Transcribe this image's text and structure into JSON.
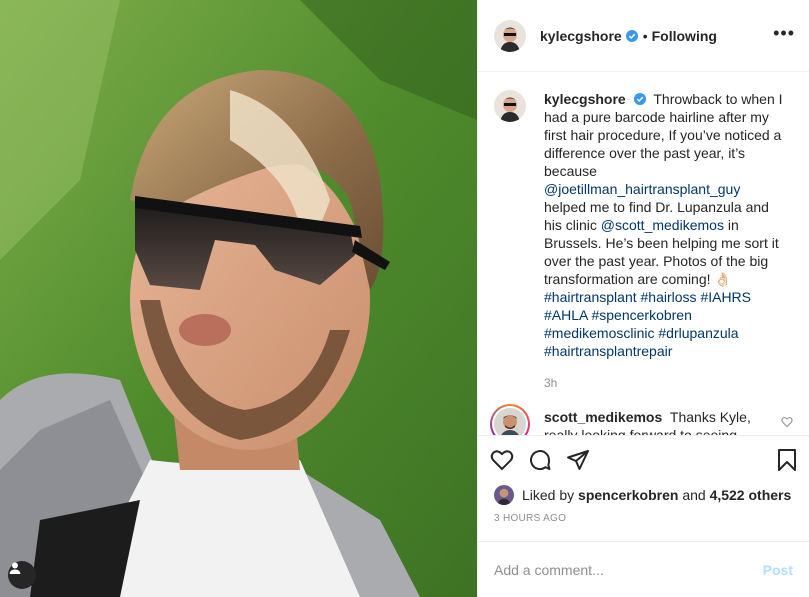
{
  "header": {
    "username": "kylecgshore",
    "separator": "•",
    "follow_status": "Following",
    "more_label": "•••"
  },
  "caption": {
    "username": "kylecgshore",
    "text_1": "Throwback to when I had a pure barcode hairline after my first hair procedure, If you’ve noticed a difference over the past year, it’s because",
    "mention_1": "@joetillman_hairtransplant_guy",
    "text_2": "helped me to find Dr. Lupanzula and his clinic",
    "mention_2": "@scott_medikemos",
    "text_3": "in Brussels. He’s been helping me sort it over the past year. Photos of the big transformation are coming! 👌🏻",
    "hashtags": [
      "#hairtransplant",
      "#hairloss",
      "#IAHRS",
      "#AHLA",
      "#spencerkobren",
      "#medikemosclinic",
      "#drlupanzula",
      "#hairtransplantrepair"
    ],
    "age": "3h"
  },
  "comment": {
    "username": "scott_medikemos",
    "text": "Thanks Kyle, really looking forward to seeing your updated pics 🤞🏼"
  },
  "actions": {
    "icons": [
      "heart-icon",
      "comment-icon",
      "share-icon",
      "bookmark-icon"
    ]
  },
  "likes": {
    "prefix": "Liked by",
    "user": "spencerkobren",
    "middle": "and",
    "count": "4,522 others"
  },
  "timestamp": "3 HOURS AGO",
  "add_comment": {
    "placeholder": "Add a comment...",
    "post_label": "Post"
  },
  "colors": {
    "link": "#00376b",
    "verified": "#3897f0",
    "muted": "#8e8e8e",
    "post_disabled": "#b2dffc"
  }
}
